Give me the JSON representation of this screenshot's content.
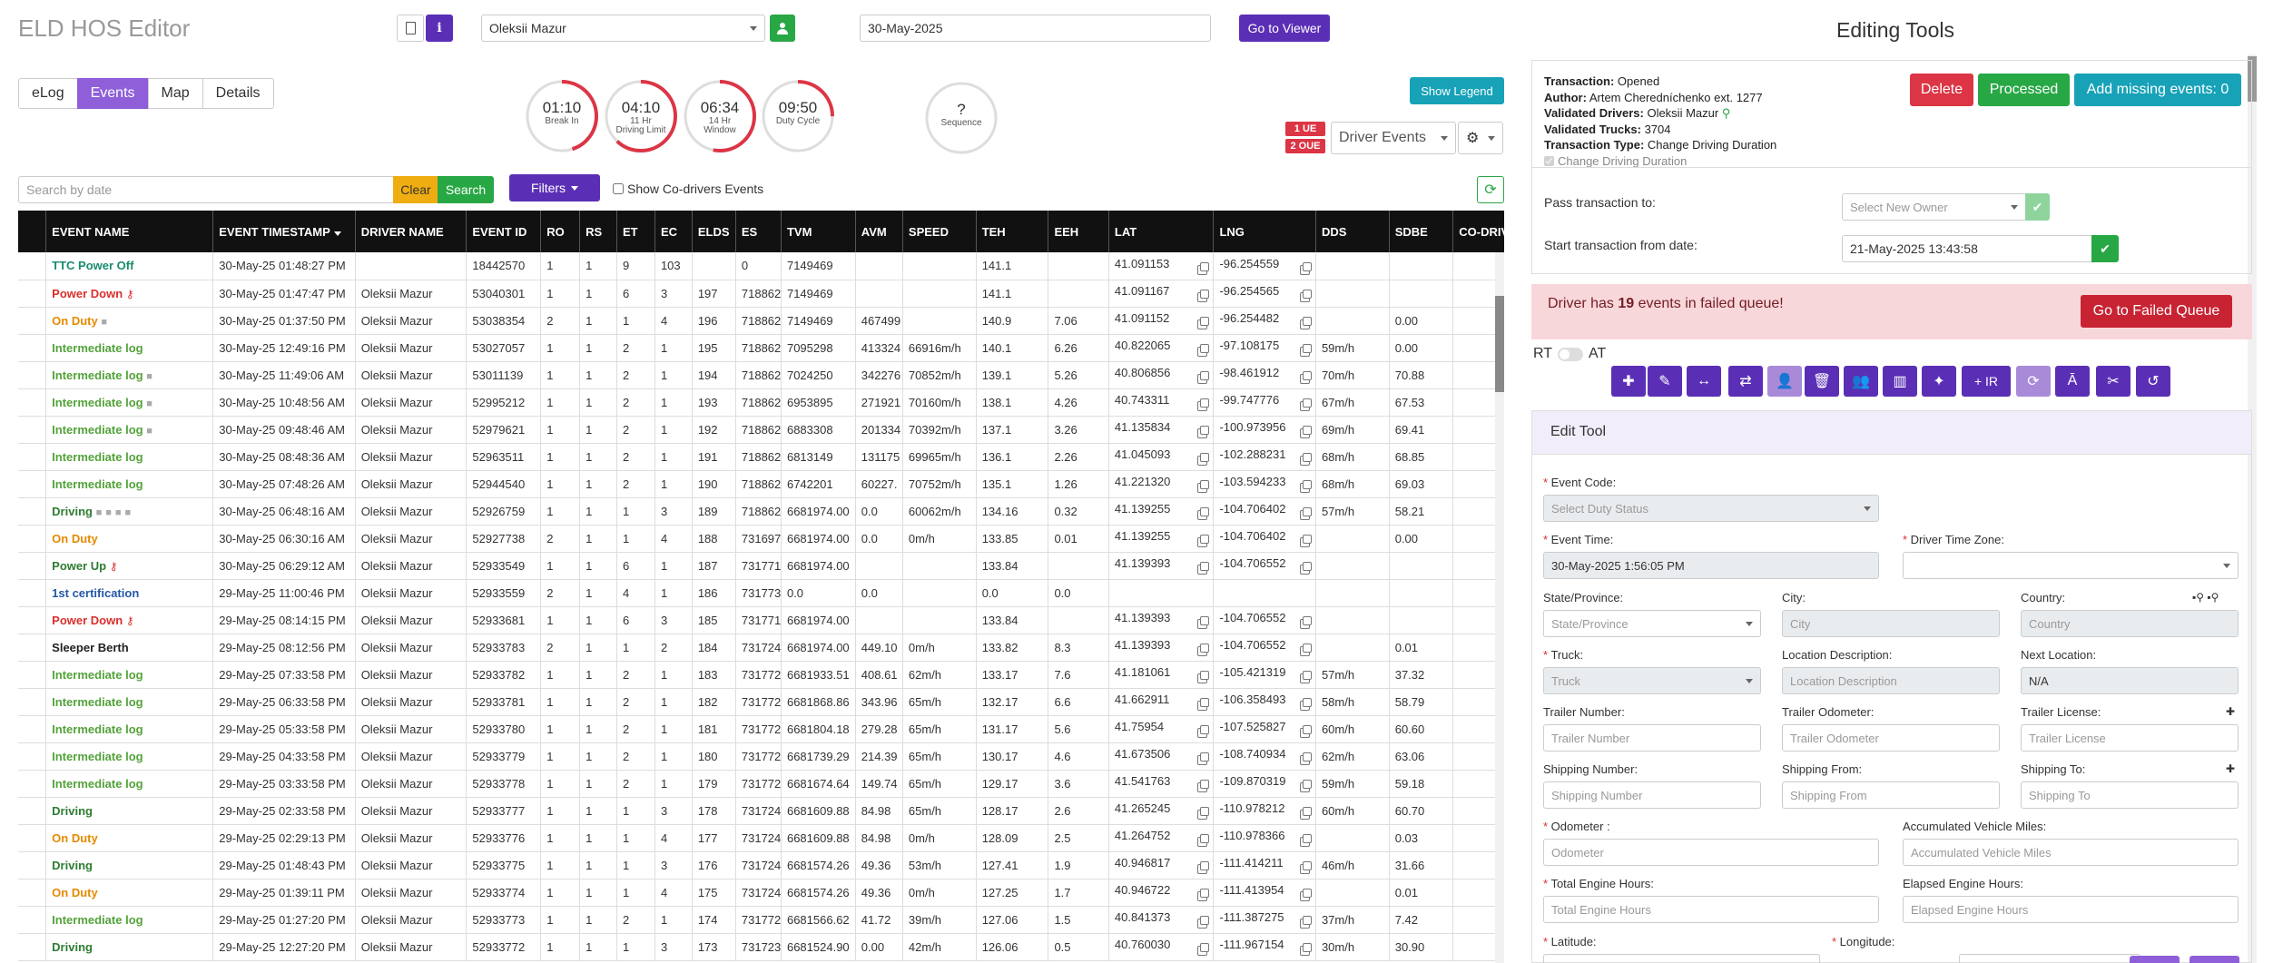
{
  "header": {
    "title": "ELD HOS Editor",
    "driver": "Oleksii Mazur",
    "date": "30-May-2025",
    "goto_viewer": "Go to Viewer"
  },
  "tabs": [
    "eLog",
    "Events",
    "Map",
    "Details"
  ],
  "gauges": [
    {
      "value": "01:10",
      "label1": "Break In",
      "label2": "",
      "fraction": 0.45
    },
    {
      "value": "04:10",
      "label1": "11 Hr",
      "label2": "Driving Limit",
      "fraction": 0.62
    },
    {
      "value": "06:34",
      "label1": "14 Hr",
      "label2": "Window",
      "fraction": 0.53
    },
    {
      "value": "09:50",
      "label1": "Duty Cycle",
      "label2": "",
      "fraction": 0.25
    },
    {
      "value": "?",
      "label1": "Sequence",
      "label2": "",
      "fraction": 0
    }
  ],
  "toolbar": {
    "show_legend": "Show Legend",
    "badge_ue": "1 UE",
    "badge_oue": "2 OUE",
    "driver_events": "Driver Events"
  },
  "search": {
    "placeholder": "Search by date",
    "clear": "Clear",
    "search": "Search",
    "filters": "Filters",
    "show_codrivers": "Show Co-drivers Events"
  },
  "table": {
    "headers": [
      "EVENT NAME",
      "EVENT TIMESTAMP",
      "DRIVER NAME",
      "EVENT ID",
      "RO",
      "RS",
      "ET",
      "EC",
      "ELDS",
      "ES",
      "TVM",
      "AVM",
      "SPEED",
      "TEH",
      "EEH",
      "LAT",
      "LNG",
      "DDS",
      "SDBE",
      "CO-DRIVER"
    ],
    "rows": [
      {
        "name": "TTC Power Off",
        "cls": "ev-teal",
        "icons": "",
        "ts": "30-May-25 01:48:27 PM",
        "driver": "",
        "id": "18442570",
        "ro": "1",
        "rs": "1",
        "et": "9",
        "ec": "103",
        "elds": "",
        "es": "0",
        "tvm": "7149469",
        "avm": "",
        "speed": "",
        "teh": "141.1",
        "eeh": "",
        "lat": "41.091153",
        "lng": "-96.254559",
        "dds": "",
        "sdbe": ""
      },
      {
        "name": "Power Down",
        "cls": "ev-red",
        "icons": "key",
        "ts": "30-May-25 01:47:47 PM",
        "driver": "Oleksii Mazur",
        "id": "53040301",
        "ro": "1",
        "rs": "1",
        "et": "6",
        "ec": "3",
        "elds": "197",
        "es": "718862",
        "tvm": "7149469",
        "avm": "",
        "speed": "",
        "teh": "141.1",
        "eeh": "",
        "lat": "41.091167",
        "lng": "-96.254565",
        "dds": "",
        "sdbe": ""
      },
      {
        "name": "On Duty",
        "cls": "ev-orange",
        "icons": "cam",
        "ts": "30-May-25 01:37:50 PM",
        "driver": "Oleksii Mazur",
        "id": "53038354",
        "ro": "2",
        "rs": "1",
        "et": "1",
        "ec": "4",
        "elds": "196",
        "es": "718862",
        "tvm": "7149469",
        "avm": "467499",
        "speed": "",
        "teh": "140.9",
        "eeh": "7.06",
        "lat": "41.091152",
        "lng": "-96.254482",
        "dds": "",
        "sdbe": "0.00"
      },
      {
        "name": "Intermediate log",
        "cls": "ev-green",
        "icons": "",
        "ts": "30-May-25 12:49:16 PM",
        "driver": "Oleksii Mazur",
        "id": "53027057",
        "ro": "1",
        "rs": "1",
        "et": "2",
        "ec": "1",
        "elds": "195",
        "es": "718862",
        "tvm": "7095298",
        "avm": "413324",
        "speed": "66916m/h",
        "teh": "140.1",
        "eeh": "6.26",
        "lat": "40.822065",
        "lng": "-97.108175",
        "dds": "59m/h",
        "sdbe": "0.00"
      },
      {
        "name": "Intermediate log",
        "cls": "ev-green",
        "icons": "cam",
        "ts": "30-May-25 11:49:06 AM",
        "driver": "Oleksii Mazur",
        "id": "53011139",
        "ro": "1",
        "rs": "1",
        "et": "2",
        "ec": "1",
        "elds": "194",
        "es": "718862",
        "tvm": "7024250",
        "avm": "342276",
        "speed": "70852m/h",
        "teh": "139.1",
        "eeh": "5.26",
        "lat": "40.806856",
        "lng": "-98.461912",
        "dds": "70m/h",
        "sdbe": "70.88"
      },
      {
        "name": "Intermediate log",
        "cls": "ev-green",
        "icons": "cam",
        "ts": "30-May-25 10:48:56 AM",
        "driver": "Oleksii Mazur",
        "id": "52995212",
        "ro": "1",
        "rs": "1",
        "et": "2",
        "ec": "1",
        "elds": "193",
        "es": "718862",
        "tvm": "6953895",
        "avm": "271921",
        "speed": "70160m/h",
        "teh": "138.1",
        "eeh": "4.26",
        "lat": "40.743311",
        "lng": "-99.747776",
        "dds": "67m/h",
        "sdbe": "67.53"
      },
      {
        "name": "Intermediate log",
        "cls": "ev-green",
        "icons": "cam",
        "ts": "30-May-25 09:48:46 AM",
        "driver": "Oleksii Mazur",
        "id": "52979621",
        "ro": "1",
        "rs": "1",
        "et": "2",
        "ec": "1",
        "elds": "192",
        "es": "718862",
        "tvm": "6883308",
        "avm": "201334",
        "speed": "70392m/h",
        "teh": "137.1",
        "eeh": "3.26",
        "lat": "41.135834",
        "lng": "-100.973956",
        "dds": "69m/h",
        "sdbe": "69.41"
      },
      {
        "name": "Intermediate log",
        "cls": "ev-green",
        "icons": "",
        "ts": "30-May-25 08:48:36 AM",
        "driver": "Oleksii Mazur",
        "id": "52963511",
        "ro": "1",
        "rs": "1",
        "et": "2",
        "ec": "1",
        "elds": "191",
        "es": "718862",
        "tvm": "6813149",
        "avm": "131175",
        "speed": "69965m/h",
        "teh": "136.1",
        "eeh": "2.26",
        "lat": "41.045093",
        "lng": "-102.288231",
        "dds": "68m/h",
        "sdbe": "68.85"
      },
      {
        "name": "Intermediate log",
        "cls": "ev-green",
        "icons": "",
        "ts": "30-May-25 07:48:26 AM",
        "driver": "Oleksii Mazur",
        "id": "52944540",
        "ro": "1",
        "rs": "1",
        "et": "2",
        "ec": "1",
        "elds": "190",
        "es": "718862",
        "tvm": "6742201",
        "avm": "60227.",
        "speed": "70752m/h",
        "teh": "135.1",
        "eeh": "1.26",
        "lat": "41.221320",
        "lng": "-103.594233",
        "dds": "68m/h",
        "sdbe": "69.03"
      },
      {
        "name": "Driving",
        "cls": "ev-darkgreen",
        "icons": "cam4",
        "ts": "30-May-25 06:48:16 AM",
        "driver": "Oleksii Mazur",
        "id": "52926759",
        "ro": "1",
        "rs": "1",
        "et": "1",
        "ec": "3",
        "elds": "189",
        "es": "718862",
        "tvm": "6681974.00",
        "avm": "0.0",
        "speed": "60062m/h",
        "teh": "134.16",
        "eeh": "0.32",
        "lat": "41.139255",
        "lng": "-104.706402",
        "dds": "57m/h",
        "sdbe": "58.21"
      },
      {
        "name": "On Duty",
        "cls": "ev-orange",
        "icons": "",
        "ts": "30-May-25 06:30:16 AM",
        "driver": "Oleksii Mazur",
        "id": "52927738",
        "ro": "2",
        "rs": "1",
        "et": "1",
        "ec": "4",
        "elds": "188",
        "es": "731697",
        "tvm": "6681974.00",
        "avm": "0.0",
        "speed": "0m/h",
        "teh": "133.85",
        "eeh": "0.01",
        "lat": "41.139255",
        "lng": "-104.706402",
        "dds": "",
        "sdbe": "0.00"
      },
      {
        "name": "Power Up",
        "cls": "ev-darkgreen",
        "icons": "key",
        "ts": "30-May-25 06:29:12 AM",
        "driver": "Oleksii Mazur",
        "id": "52933549",
        "ro": "1",
        "rs": "1",
        "et": "6",
        "ec": "1",
        "elds": "187",
        "es": "731771",
        "tvm": "6681974.00",
        "avm": "",
        "speed": "",
        "teh": "133.84",
        "eeh": "",
        "lat": "41.139393",
        "lng": "-104.706552",
        "dds": "",
        "sdbe": ""
      },
      {
        "name": "1st certification",
        "cls": "ev-blue",
        "icons": "",
        "ts": "29-May-25 11:00:46 PM",
        "driver": "Oleksii Mazur",
        "id": "52933559",
        "ro": "2",
        "rs": "1",
        "et": "4",
        "ec": "1",
        "elds": "186",
        "es": "731773",
        "tvm": "0.0",
        "avm": "0.0",
        "speed": "",
        "teh": "0.0",
        "eeh": "0.0",
        "lat": "",
        "lng": "",
        "dds": "",
        "sdbe": ""
      },
      {
        "name": "Power Down",
        "cls": "ev-red",
        "icons": "key",
        "ts": "29-May-25 08:14:15 PM",
        "driver": "Oleksii Mazur",
        "id": "52933681",
        "ro": "1",
        "rs": "1",
        "et": "6",
        "ec": "3",
        "elds": "185",
        "es": "731771",
        "tvm": "6681974.00",
        "avm": "",
        "speed": "",
        "teh": "133.84",
        "eeh": "",
        "lat": "41.139393",
        "lng": "-104.706552",
        "dds": "",
        "sdbe": ""
      },
      {
        "name": "Sleeper Berth",
        "cls": "ev-black",
        "icons": "",
        "ts": "29-May-25 08:12:56 PM",
        "driver": "Oleksii Mazur",
        "id": "52933783",
        "ro": "2",
        "rs": "1",
        "et": "1",
        "ec": "2",
        "elds": "184",
        "es": "731724",
        "tvm": "6681974.00",
        "avm": "449.10",
        "speed": "0m/h",
        "teh": "133.82",
        "eeh": "8.3",
        "lat": "41.139393",
        "lng": "-104.706552",
        "dds": "",
        "sdbe": "0.01"
      },
      {
        "name": "Intermediate log",
        "cls": "ev-green",
        "icons": "",
        "ts": "29-May-25 07:33:58 PM",
        "driver": "Oleksii Mazur",
        "id": "52933782",
        "ro": "1",
        "rs": "1",
        "et": "2",
        "ec": "1",
        "elds": "183",
        "es": "731772",
        "tvm": "6681933.51",
        "avm": "408.61",
        "speed": "62m/h",
        "teh": "133.17",
        "eeh": "7.6",
        "lat": "41.181061",
        "lng": "-105.421319",
        "dds": "57m/h",
        "sdbe": "37.32"
      },
      {
        "name": "Intermediate log",
        "cls": "ev-green",
        "icons": "",
        "ts": "29-May-25 06:33:58 PM",
        "driver": "Oleksii Mazur",
        "id": "52933781",
        "ro": "1",
        "rs": "1",
        "et": "2",
        "ec": "1",
        "elds": "182",
        "es": "731772",
        "tvm": "6681868.86",
        "avm": "343.96",
        "speed": "65m/h",
        "teh": "132.17",
        "eeh": "6.6",
        "lat": "41.662911",
        "lng": "-106.358493",
        "dds": "58m/h",
        "sdbe": "58.79"
      },
      {
        "name": "Intermediate log",
        "cls": "ev-green",
        "icons": "",
        "ts": "29-May-25 05:33:58 PM",
        "driver": "Oleksii Mazur",
        "id": "52933780",
        "ro": "1",
        "rs": "1",
        "et": "2",
        "ec": "1",
        "elds": "181",
        "es": "731772",
        "tvm": "6681804.18",
        "avm": "279.28",
        "speed": "65m/h",
        "teh": "131.17",
        "eeh": "5.6",
        "lat": "41.75954",
        "lng": "-107.525827",
        "dds": "60m/h",
        "sdbe": "60.60"
      },
      {
        "name": "Intermediate log",
        "cls": "ev-green",
        "icons": "",
        "ts": "29-May-25 04:33:58 PM",
        "driver": "Oleksii Mazur",
        "id": "52933779",
        "ro": "1",
        "rs": "1",
        "et": "2",
        "ec": "1",
        "elds": "180",
        "es": "731772",
        "tvm": "6681739.29",
        "avm": "214.39",
        "speed": "65m/h",
        "teh": "130.17",
        "eeh": "4.6",
        "lat": "41.673506",
        "lng": "-108.740934",
        "dds": "62m/h",
        "sdbe": "63.06"
      },
      {
        "name": "Intermediate log",
        "cls": "ev-green",
        "icons": "",
        "ts": "29-May-25 03:33:58 PM",
        "driver": "Oleksii Mazur",
        "id": "52933778",
        "ro": "1",
        "rs": "1",
        "et": "2",
        "ec": "1",
        "elds": "179",
        "es": "731772",
        "tvm": "6681674.64",
        "avm": "149.74",
        "speed": "65m/h",
        "teh": "129.17",
        "eeh": "3.6",
        "lat": "41.541763",
        "lng": "-109.870319",
        "dds": "59m/h",
        "sdbe": "59.18"
      },
      {
        "name": "Driving",
        "cls": "ev-darkgreen",
        "icons": "",
        "ts": "29-May-25 02:33:58 PM",
        "driver": "Oleksii Mazur",
        "id": "52933777",
        "ro": "1",
        "rs": "1",
        "et": "1",
        "ec": "3",
        "elds": "178",
        "es": "731724",
        "tvm": "6681609.88",
        "avm": "84.98",
        "speed": "65m/h",
        "teh": "128.17",
        "eeh": "2.6",
        "lat": "41.265245",
        "lng": "-110.978212",
        "dds": "60m/h",
        "sdbe": "60.70"
      },
      {
        "name": "On Duty",
        "cls": "ev-orange",
        "icons": "",
        "ts": "29-May-25 02:29:13 PM",
        "driver": "Oleksii Mazur",
        "id": "52933776",
        "ro": "1",
        "rs": "1",
        "et": "1",
        "ec": "4",
        "elds": "177",
        "es": "731724",
        "tvm": "6681609.88",
        "avm": "84.98",
        "speed": "0m/h",
        "teh": "128.09",
        "eeh": "2.5",
        "lat": "41.264752",
        "lng": "-110.978366",
        "dds": "",
        "sdbe": "0.03"
      },
      {
        "name": "Driving",
        "cls": "ev-darkgreen",
        "icons": "",
        "ts": "29-May-25 01:48:43 PM",
        "driver": "Oleksii Mazur",
        "id": "52933775",
        "ro": "1",
        "rs": "1",
        "et": "1",
        "ec": "3",
        "elds": "176",
        "es": "731724",
        "tvm": "6681574.26",
        "avm": "49.36",
        "speed": "53m/h",
        "teh": "127.41",
        "eeh": "1.9",
        "lat": "40.946817",
        "lng": "-111.414211",
        "dds": "46m/h",
        "sdbe": "31.66"
      },
      {
        "name": "On Duty",
        "cls": "ev-orange",
        "icons": "",
        "ts": "29-May-25 01:39:11 PM",
        "driver": "Oleksii Mazur",
        "id": "52933774",
        "ro": "1",
        "rs": "1",
        "et": "1",
        "ec": "4",
        "elds": "175",
        "es": "731724",
        "tvm": "6681574.26",
        "avm": "49.36",
        "speed": "0m/h",
        "teh": "127.25",
        "eeh": "1.7",
        "lat": "40.946722",
        "lng": "-111.413954",
        "dds": "",
        "sdbe": "0.01"
      },
      {
        "name": "Intermediate log",
        "cls": "ev-green",
        "icons": "",
        "ts": "29-May-25 01:27:20 PM",
        "driver": "Oleksii Mazur",
        "id": "52933773",
        "ro": "1",
        "rs": "1",
        "et": "2",
        "ec": "1",
        "elds": "174",
        "es": "731772",
        "tvm": "6681566.62",
        "avm": "41.72",
        "speed": "39m/h",
        "teh": "127.06",
        "eeh": "1.5",
        "lat": "40.841373",
        "lng": "-111.387275",
        "dds": "37m/h",
        "sdbe": "7.42"
      },
      {
        "name": "Driving",
        "cls": "ev-darkgreen",
        "icons": "",
        "ts": "29-May-25 12:27:20 PM",
        "driver": "Oleksii Mazur",
        "id": "52933772",
        "ro": "1",
        "rs": "1",
        "et": "1",
        "ec": "3",
        "elds": "173",
        "es": "731723",
        "tvm": "6681524.90",
        "avm": "0.00",
        "speed": "42m/h",
        "teh": "126.06",
        "eeh": "0.5",
        "lat": "40.760030",
        "lng": "-111.967154",
        "dds": "30m/h",
        "sdbe": "30.90"
      }
    ]
  },
  "editing": {
    "title": "Editing Tools",
    "transaction_label": "Transaction:",
    "transaction": "Opened",
    "author_label": "Author:",
    "author": "Artem Cheredníchenko ext. 1277",
    "validated_drivers_label": "Validated Drivers:",
    "validated_drivers": "Oleksii Mazur",
    "validated_trucks_label": "Validated Trucks:",
    "validated_trucks": "3704",
    "transaction_type_label": "Transaction Type:",
    "transaction_type": "Change Driving Duration",
    "checkbox_label": "Change Driving Duration",
    "delete": "Delete",
    "processed": "Processed",
    "add_missing": "Add missing events: 0",
    "pass_label": "Pass transaction to:",
    "pass_placeholder": "Select New Owner",
    "start_label": "Start transaction from date:",
    "start_value": "21-May-2025 13:43:58",
    "alert_pre": "Driver has ",
    "alert_count": "19",
    "alert_post": " events in failed queue!",
    "failed_btn": "Go to Failed Queue",
    "rt": "RT",
    "at": "AT",
    "ir": "+ IR",
    "edit_tool": "Edit Tool",
    "event_code": "Event Code:",
    "event_code_ph": "Select Duty Status",
    "event_time": "Event Time:",
    "event_time_val": "30-May-2025 1:56:05 PM",
    "tz": "Driver Time Zone:",
    "state": "State/Province:",
    "state_ph": "State/Province",
    "city": "City:",
    "city_ph": "City",
    "country": "Country:",
    "country_ph": "Country",
    "truck": "Truck:",
    "truck_ph": "Truck",
    "locdesc": "Location Description:",
    "locdesc_ph": "Location Description",
    "nextloc": "Next Location:",
    "nextloc_val": "N/A",
    "trailer_num": "Trailer Number:",
    "trailer_num_ph": "Trailer Number",
    "trailer_odo": "Trailer Odometer:",
    "trailer_odo_ph": "Trailer Odometer",
    "trailer_lic": "Trailer License:",
    "trailer_lic_ph": "Trailer License",
    "ship_num": "Shipping Number:",
    "ship_num_ph": "Shipping Number",
    "ship_from": "Shipping From:",
    "ship_from_ph": "Shipping From",
    "ship_to": "Shipping To:",
    "ship_to_ph": "Shipping To",
    "odometer": "Odometer :",
    "odometer_ph": "Odometer",
    "acc_miles": "Accumulated Vehicle Miles:",
    "acc_miles_ph": "Accumulated Vehicle Miles",
    "engine_hours": "Total Engine Hours:",
    "engine_hours_ph": "Total Engine Hours",
    "elapsed_hours": "Elapsed Engine Hours:",
    "elapsed_hours_ph": "Elapsed Engine Hours",
    "latitude": "Latitude:",
    "longitude": "Longitude:"
  }
}
